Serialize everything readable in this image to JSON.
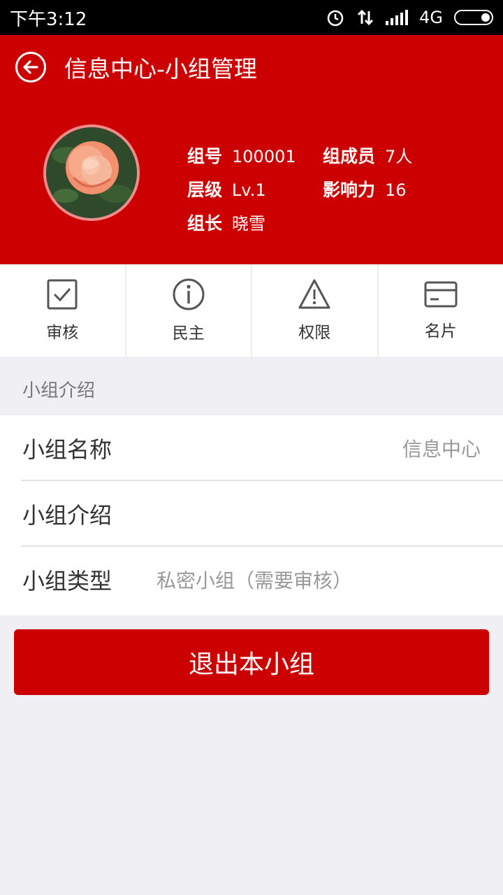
{
  "status_bar": {
    "time": "下午3:12",
    "network": "4G"
  },
  "header": {
    "title": "信息中心-小组管理"
  },
  "group_info": {
    "number": {
      "label": "组号",
      "value": "100001"
    },
    "members": {
      "label": "组成员",
      "value": "7人"
    },
    "level": {
      "label": "层级",
      "value": "Lv.1"
    },
    "influence": {
      "label": "影响力",
      "value": "16"
    },
    "leader": {
      "label": "组长",
      "value": "晓雪"
    }
  },
  "tools": [
    {
      "label": "审核",
      "icon": "checkbox-icon"
    },
    {
      "label": "民主",
      "icon": "info-icon"
    },
    {
      "label": "权限",
      "icon": "warning-icon"
    },
    {
      "label": "名片",
      "icon": "card-icon"
    }
  ],
  "section": {
    "title": "小组介绍"
  },
  "fields": {
    "name": {
      "label": "小组名称",
      "value": "信息中心"
    },
    "intro": {
      "label": "小组介绍",
      "value": ""
    },
    "type": {
      "label": "小组类型",
      "value": "私密小组（需要审核）"
    }
  },
  "actions": {
    "exit_label": "退出本小组"
  },
  "colors": {
    "brand_red": "#cc0000",
    "background": "#efeff4"
  }
}
